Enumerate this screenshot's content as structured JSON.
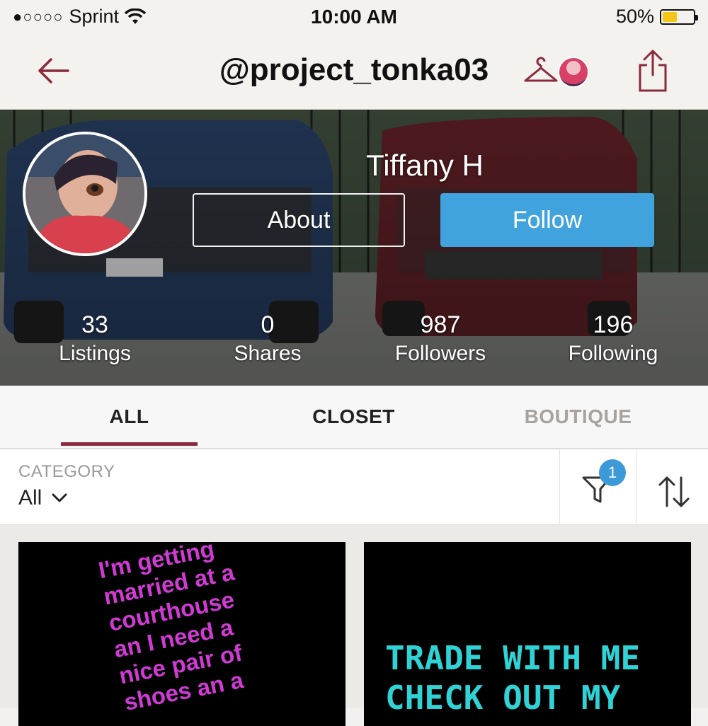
{
  "status_bar": {
    "signal_dots": "●○○○○",
    "carrier": "Sprint",
    "time": "10:00 AM",
    "battery_percent": "50%",
    "battery_level": 0.5
  },
  "nav": {
    "title": "@project_tonka03"
  },
  "profile": {
    "name": "Tiffany H",
    "about_label": "About",
    "follow_label": "Follow",
    "stats": [
      {
        "value": "33",
        "label": "Listings"
      },
      {
        "value": "0",
        "label": "Shares"
      },
      {
        "value": "987",
        "label": "Followers"
      },
      {
        "value": "196",
        "label": "Following"
      }
    ]
  },
  "tabs": [
    {
      "label": "ALL",
      "active": true
    },
    {
      "label": "CLOSET",
      "active": false
    },
    {
      "label": "BOUTIQUE",
      "active": false
    }
  ],
  "filters": {
    "category_label": "CATEGORY",
    "category_value": "All",
    "filter_badge_count": "1"
  },
  "listings": [
    {
      "image_text": "I'm getting\nmarried at a\ncourthouse\nan I need a\nnice pair of\nshoes an a"
    },
    {
      "image_text": "TRADE WITH ME\nCHECK OUT MY"
    }
  ],
  "colors": {
    "accent": "#8a2a3a",
    "follow_button": "#41a3dd",
    "badge": "#3d9ad8"
  }
}
